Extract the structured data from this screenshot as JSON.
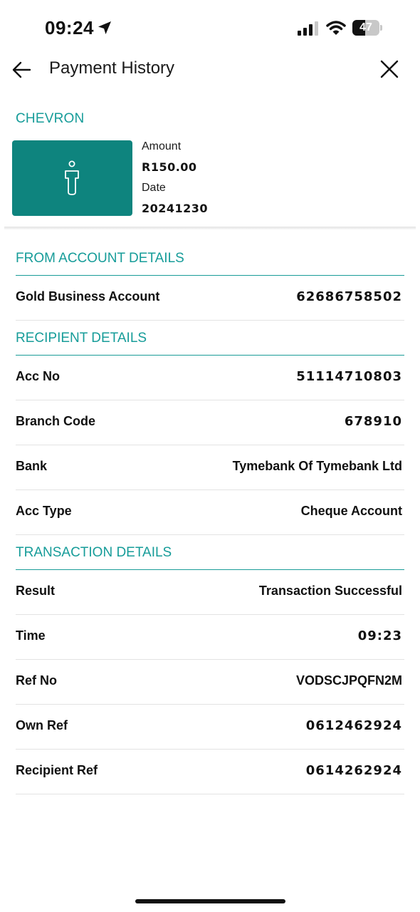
{
  "status_bar": {
    "time": "09:24",
    "battery": "47",
    "battery_level": 0.47
  },
  "nav": {
    "title": "Payment History"
  },
  "summary": {
    "merchant": "CHEVRON",
    "amount_label": "Amount",
    "amount_value": "R150.00",
    "date_label": "Date",
    "date_value": "20241230"
  },
  "from_account": {
    "title": "FROM ACCOUNT DETAILS",
    "rows": [
      {
        "label": "Gold Business Account",
        "value": "62686758502"
      }
    ]
  },
  "recipient": {
    "title": "RECIPIENT DETAILS",
    "rows": [
      {
        "label": "Acc No",
        "value": "51114710803"
      },
      {
        "label": "Branch Code",
        "value": "678910"
      },
      {
        "label": "Bank",
        "value": "Tymebank Of Tymebank Ltd"
      },
      {
        "label": "Acc Type",
        "value": "Cheque Account"
      }
    ]
  },
  "transaction": {
    "title": "TRANSACTION DETAILS",
    "rows": [
      {
        "label": "Result",
        "value": "Transaction Successful"
      },
      {
        "label": "Time",
        "value": "09:23"
      },
      {
        "label": "Ref No",
        "value": "VODSCJPQFN2M"
      },
      {
        "label": "Own Ref",
        "value": "0612462924"
      },
      {
        "label": "Recipient Ref",
        "value": "0614262924"
      }
    ]
  },
  "colors": {
    "accent": "#169c99",
    "card": "#0e847e",
    "divider": "#e3e3e3"
  },
  "icons": [
    "location-arrow-icon",
    "cellular-signal-icon",
    "wifi-icon",
    "battery-icon",
    "back-arrow-icon",
    "close-icon",
    "person-icon"
  ]
}
